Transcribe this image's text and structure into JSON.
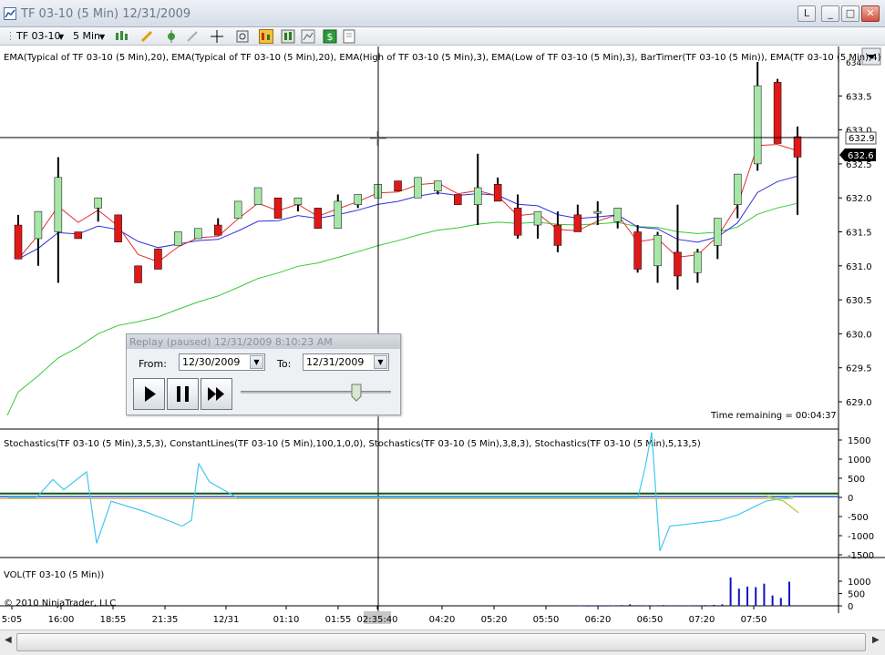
{
  "window": {
    "title": "TF 03-10 (5 Min)  12/31/2009",
    "buttons": [
      "L",
      "_",
      "□",
      "✕"
    ]
  },
  "toolbar": {
    "instrument": "TF 03-10",
    "interval": "5 Min"
  },
  "price_panel": {
    "indicator_label": "EMA(Typical of TF 03-10 (5 Min),20), EMA(Typical of TF 03-10 (5 Min),20), EMA(High of TF 03-10 (5 Min),3), EMA(Low of TF 03-10 (5 Min),3), BarTimer(TF 03-10 (5 Min)), EMA(TF 03-10 (5 Min),4)",
    "price_axis": [
      "633.5",
      "633.0",
      "632.5",
      "632.0",
      "631.5",
      "631.0",
      "630.5",
      "630.0",
      "629.5",
      "629.0"
    ],
    "top_label": "634",
    "crosshair_price": "632.9",
    "last_price": "632.6",
    "time_remaining": "Time remaining = 00:04:37"
  },
  "replay": {
    "header": "Replay (paused) 12/31/2009 8:10:23 AM",
    "from_label": "From:",
    "from_value": "12/30/2009",
    "to_label": "To:",
    "to_value": "12/31/2009"
  },
  "stoch_panel": {
    "label": "Stochastics(TF 03-10 (5 Min),3,5,3), ConstantLines(TF 03-10 (5 Min),100,1,0,0), Stochastics(TF 03-10 (5 Min),3,8,3), Stochastics(TF 03-10 (5 Min),5,13,5)",
    "axis": [
      "1500",
      "1000",
      "500",
      "0",
      "-500",
      "-1000",
      "-1500"
    ]
  },
  "vol_panel": {
    "label": "VOL(TF 03-10 (5 Min))",
    "axis": [
      "1000",
      "500",
      "0"
    ],
    "copyright": "© 2010 NinjaTrader, LLC"
  },
  "time_axis": [
    "5:05",
    "16:00",
    "18:55",
    "21:35",
    "12/31",
    "01:10",
    "01:55",
    "02:35:40",
    "04:20",
    "05:20",
    "05:50",
    "06:20",
    "06:50",
    "07:20",
    "07:50"
  ],
  "colors": {
    "up_candle": "#a8e6a8",
    "down_candle": "#e01818",
    "ema_red": "#e03030",
    "ema_blue": "#3030e0",
    "ema_green": "#38c838",
    "stoch_cyan": "#40c8f0",
    "volume": "#1010c8"
  },
  "chart_data": {
    "type": "candlestick",
    "candles": [
      {
        "o": 631.6,
        "h": 631.75,
        "l": 631.1,
        "c": 631.1
      },
      {
        "o": 631.4,
        "h": 631.8,
        "l": 631.0,
        "c": 631.8
      },
      {
        "o": 631.5,
        "h": 632.6,
        "l": 630.75,
        "c": 632.3
      },
      {
        "o": 631.5,
        "h": 631.5,
        "l": 631.4,
        "c": 631.4
      },
      {
        "o": 631.85,
        "h": 632.0,
        "l": 631.65,
        "c": 632.0
      },
      {
        "o": 631.75,
        "h": 631.75,
        "l": 631.35,
        "c": 631.35
      },
      {
        "o": 631.0,
        "h": 631.0,
        "l": 630.75,
        "c": 630.75
      },
      {
        "o": 631.25,
        "h": 631.25,
        "l": 630.95,
        "c": 630.95
      },
      {
        "o": 631.3,
        "h": 631.5,
        "l": 631.3,
        "c": 631.5
      },
      {
        "o": 631.4,
        "h": 631.55,
        "l": 631.4,
        "c": 631.55
      },
      {
        "o": 631.6,
        "h": 631.7,
        "l": 631.45,
        "c": 631.45
      },
      {
        "o": 631.7,
        "h": 631.95,
        "l": 631.7,
        "c": 631.95
      },
      {
        "o": 631.9,
        "h": 632.15,
        "l": 631.9,
        "c": 632.15
      },
      {
        "o": 632.0,
        "h": 632.0,
        "l": 631.7,
        "c": 631.7
      },
      {
        "o": 631.9,
        "h": 632.0,
        "l": 631.8,
        "c": 632.0
      },
      {
        "o": 631.85,
        "h": 631.85,
        "l": 631.55,
        "c": 631.55
      },
      {
        "o": 631.55,
        "h": 632.05,
        "l": 631.55,
        "c": 631.95
      },
      {
        "o": 631.9,
        "h": 632.05,
        "l": 631.85,
        "c": 632.05
      },
      {
        "o": 632.0,
        "h": 632.2,
        "l": 632.0,
        "c": 632.2
      },
      {
        "o": 632.25,
        "h": 632.1,
        "l": 632.1,
        "c": 632.1
      },
      {
        "o": 632.0,
        "h": 632.3,
        "l": 632.0,
        "c": 632.3
      },
      {
        "o": 632.1,
        "h": 632.25,
        "l": 632.05,
        "c": 632.25
      },
      {
        "o": 632.05,
        "h": 632.05,
        "l": 631.9,
        "c": 631.9
      },
      {
        "o": 631.9,
        "h": 632.65,
        "l": 631.6,
        "c": 632.15
      },
      {
        "o": 632.2,
        "h": 632.3,
        "l": 631.95,
        "c": 631.95
      },
      {
        "o": 631.85,
        "h": 632.05,
        "l": 631.4,
        "c": 631.45
      },
      {
        "o": 631.6,
        "h": 631.8,
        "l": 631.4,
        "c": 631.8
      },
      {
        "o": 631.6,
        "h": 631.8,
        "l": 631.2,
        "c": 631.3
      },
      {
        "o": 631.75,
        "h": 631.9,
        "l": 631.5,
        "c": 631.5
      },
      {
        "o": 631.8,
        "h": 631.95,
        "l": 631.6,
        "c": 631.8
      },
      {
        "o": 631.65,
        "h": 631.85,
        "l": 631.55,
        "c": 631.85
      },
      {
        "o": 631.5,
        "h": 631.6,
        "l": 630.9,
        "c": 630.95
      },
      {
        "o": 631.0,
        "h": 631.5,
        "l": 630.75,
        "c": 631.45
      },
      {
        "o": 631.2,
        "h": 631.9,
        "l": 630.65,
        "c": 630.85
      },
      {
        "o": 630.9,
        "h": 631.25,
        "l": 630.75,
        "c": 631.2
      },
      {
        "o": 631.3,
        "h": 631.7,
        "l": 631.1,
        "c": 631.7
      },
      {
        "o": 631.9,
        "h": 632.35,
        "l": 631.7,
        "c": 632.35
      },
      {
        "o": 632.5,
        "h": 634.0,
        "l": 632.4,
        "c": 633.65
      },
      {
        "o": 633.7,
        "h": 633.75,
        "l": 632.8,
        "c": 632.8
      },
      {
        "o": 632.9,
        "h": 633.05,
        "l": 631.75,
        "c": 632.6
      }
    ],
    "volume": [
      20,
      10,
      15,
      12,
      18,
      30,
      60,
      25,
      20,
      18,
      30,
      22,
      15,
      20,
      25,
      30,
      40,
      60,
      1150,
      700,
      780,
      760,
      900,
      420,
      320,
      980
    ]
  }
}
